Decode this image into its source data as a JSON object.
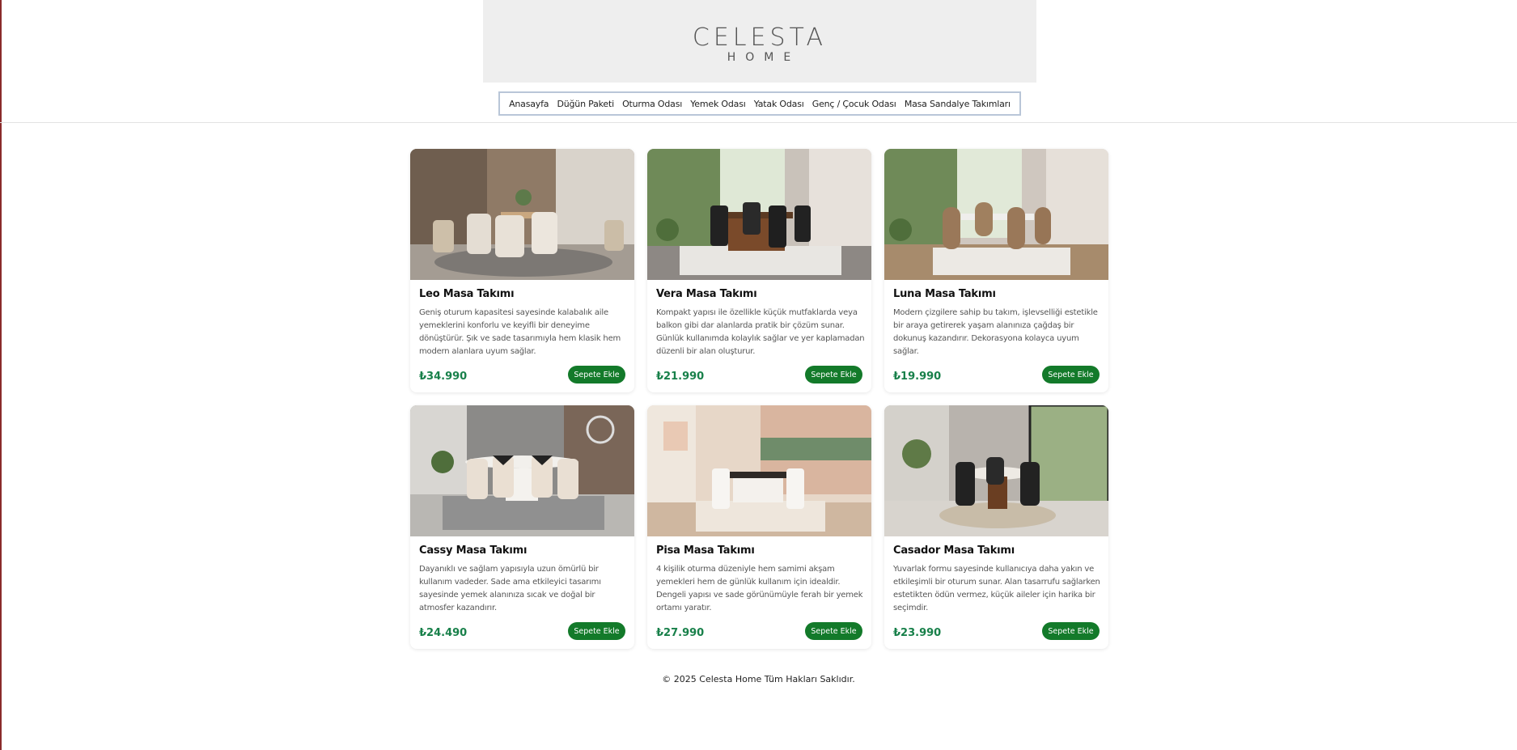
{
  "brand": {
    "name": "CELESTA",
    "sub": "HOME"
  },
  "nav": [
    "Anasayfa",
    "Düğün Paketi",
    "Oturma Odası",
    "Yemek Odası",
    "Yatak Odası",
    "Genç / Çocuk Odası",
    "Masa Sandalye Takımları"
  ],
  "products": [
    {
      "name": "Leo Masa Takımı",
      "desc": "Geniş oturum kapasitesi sayesinde kalabalık aile yemeklerini konforlu ve keyifli bir deneyime dönüştürür. Şık ve sade tasarımıyla hem klasik hem modern alanlara uyum sağlar.",
      "price": "₺34.990",
      "button": "Sepete Ekle"
    },
    {
      "name": "Vera Masa Takımı",
      "desc": "Kompakt yapısı ile özellikle küçük mutfaklarda veya balkon gibi dar alanlarda pratik bir çözüm sunar. Günlük kullanımda kolaylık sağlar ve yer kaplamadan düzenli bir alan oluşturur.",
      "price": "₺21.990",
      "button": "Sepete Ekle"
    },
    {
      "name": "Luna Masa Takımı",
      "desc": "Modern çizgilere sahip bu takım, işlevselliği estetikle bir araya getirerek yaşam alanınıza çağdaş bir dokunuş kazandırır. Dekorasyona kolayca uyum sağlar.",
      "price": "₺19.990",
      "button": "Sepete Ekle"
    },
    {
      "name": "Cassy Masa Takımı",
      "desc": "Dayanıklı ve sağlam yapısıyla uzun ömürlü bir kullanım vadeder. Sade ama etkileyici tasarımı sayesinde yemek alanınıza sıcak ve doğal bir atmosfer kazandırır.",
      "price": "₺24.490",
      "button": "Sepete Ekle"
    },
    {
      "name": "Pisa Masa Takımı",
      "desc": "4 kişilik oturma düzeniyle hem samimi akşam yemekleri hem de günlük kullanım için idealdir. Dengeli yapısı ve sade görünümüyle ferah bir yemek ortamı yaratır.",
      "price": "₺27.990",
      "button": "Sepete Ekle"
    },
    {
      "name": "Casador Masa Takımı",
      "desc": "Yuvarlak formu sayesinde kullanıcıya daha yakın ve etkileşimli bir oturum sunar. Alan tasarrufu sağlarken estetikten ödün vermez, küçük aileler için harika bir seçimdir.",
      "price": "₺23.990",
      "button": "Sepete Ekle"
    }
  ],
  "footer": "© 2025 Celesta Home Tüm Hakları Saklıdır.",
  "colors": {
    "accent": "#137a2a",
    "price": "#18804a",
    "hero_bg": "#eeeeee",
    "nav_border": "#b9c6d8"
  }
}
